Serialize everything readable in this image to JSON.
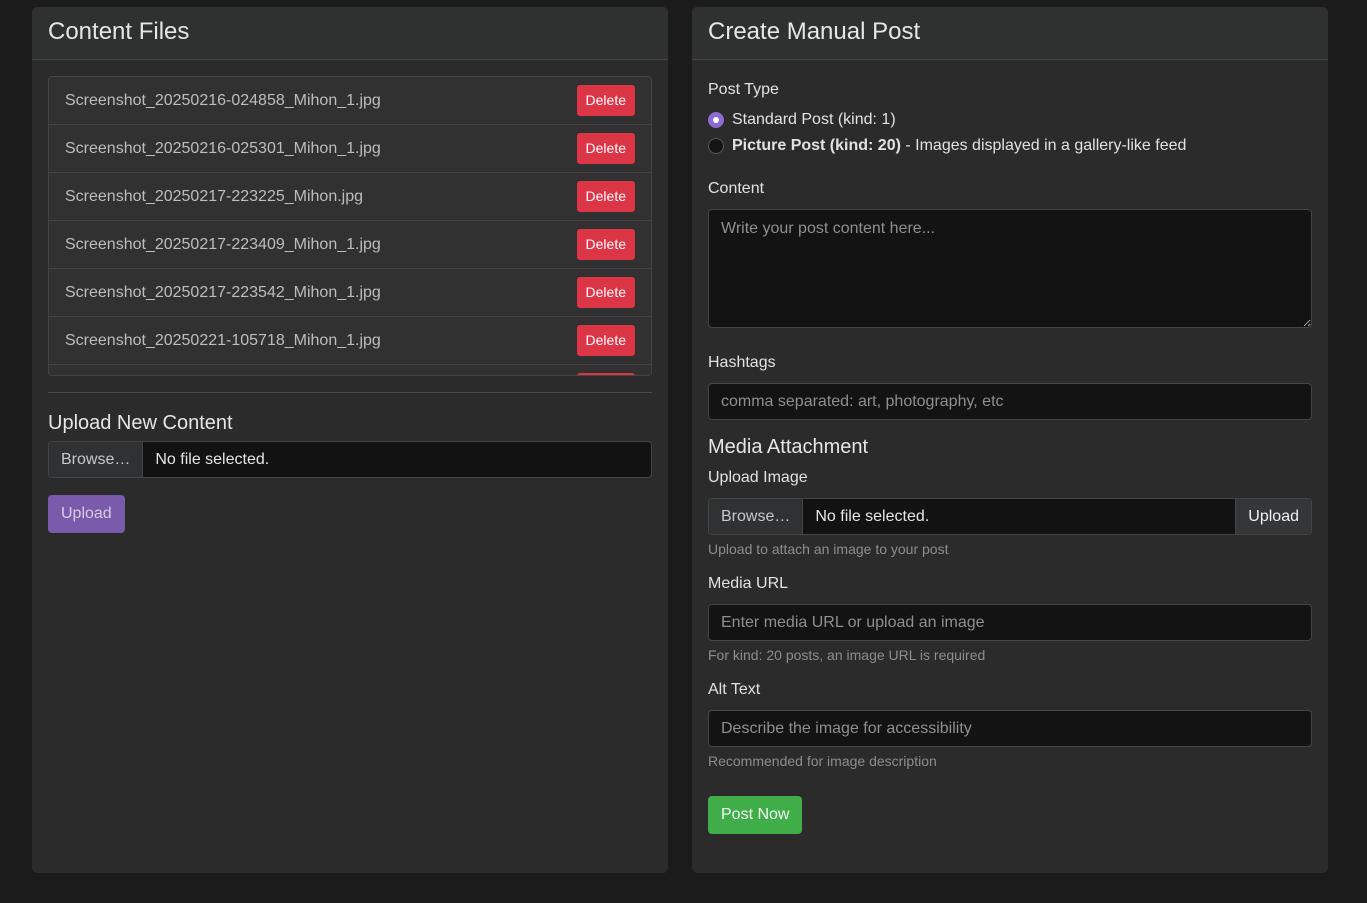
{
  "files_panel": {
    "title": "Content Files",
    "delete_label": "Delete",
    "files": [
      "Screenshot_20250216-024858_Mihon_1.jpg",
      "Screenshot_20250216-025301_Mihon_1.jpg",
      "Screenshot_20250217-223225_Mihon.jpg",
      "Screenshot_20250217-223409_Mihon_1.jpg",
      "Screenshot_20250217-223542_Mihon_1.jpg",
      "Screenshot_20250221-105718_Mihon_1.jpg"
    ],
    "upload_section_title": "Upload New Content",
    "browse_label": "Browse…",
    "file_status": "No file selected.",
    "upload_button": "Upload"
  },
  "post_panel": {
    "title": "Create Manual Post",
    "post_type_label": "Post Type",
    "option_standard": "Standard Post (kind: 1)",
    "option_picture_bold": "Picture Post (kind: 20)",
    "option_picture_rest": " - Images displayed in a gallery-like feed",
    "content_label": "Content",
    "content_placeholder": "Write your post content here...",
    "hashtags_label": "Hashtags",
    "hashtags_placeholder": "comma separated: art, photography, etc",
    "media_section_title": "Media Attachment",
    "upload_image_label": "Upload Image",
    "browse_label": "Browse…",
    "file_status": "No file selected.",
    "upload_button": "Upload",
    "upload_help": "Upload to attach an image to your post",
    "media_url_label": "Media URL",
    "media_url_placeholder": "Enter media URL or upload an image",
    "media_url_help": "For kind: 20 posts, an image URL is required",
    "alt_text_label": "Alt Text",
    "alt_text_placeholder": "Describe the image for accessibility",
    "alt_text_help": "Recommended for image description",
    "post_button": "Post Now"
  },
  "colors": {
    "delete": "#dc3545",
    "upload_purple": "#7a5aab",
    "post_green": "#3fae49",
    "radio_accent": "#8e6bd0"
  }
}
